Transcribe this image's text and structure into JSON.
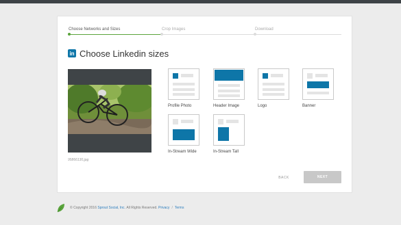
{
  "stepper": {
    "steps": [
      {
        "label": "Choose Networks and Sizes",
        "state": "active"
      },
      {
        "label": "Crop Images",
        "state": "inactive"
      },
      {
        "label": "Download",
        "state": "inactive"
      }
    ]
  },
  "page": {
    "network_icon": "linkedin-icon",
    "network_icon_text": "in",
    "title": "Choose Linkedin sizes"
  },
  "preview": {
    "filename": "95866130.jpg"
  },
  "sizes": [
    {
      "label": "Profile Photo"
    },
    {
      "label": "Header Image"
    },
    {
      "label": "Logo"
    },
    {
      "label": "Banner"
    },
    {
      "label": "In-Stream Wide"
    },
    {
      "label": "In-Stream Tall"
    }
  ],
  "actions": {
    "back_label": "BACK",
    "next_label": "NEXT"
  },
  "footer": {
    "copyright": "© Copyright 2016",
    "company_link": "Sprout Social, Inc.",
    "rights": "All Rights Reserved.",
    "privacy_link": "Privacy",
    "separator": "/",
    "terms_link": "Terms"
  },
  "colors": {
    "accent_green": "#59a33b",
    "linkedin_blue": "#0e76a8",
    "disabled_button": "#c8c8c8",
    "link": "#2c7dbd"
  }
}
